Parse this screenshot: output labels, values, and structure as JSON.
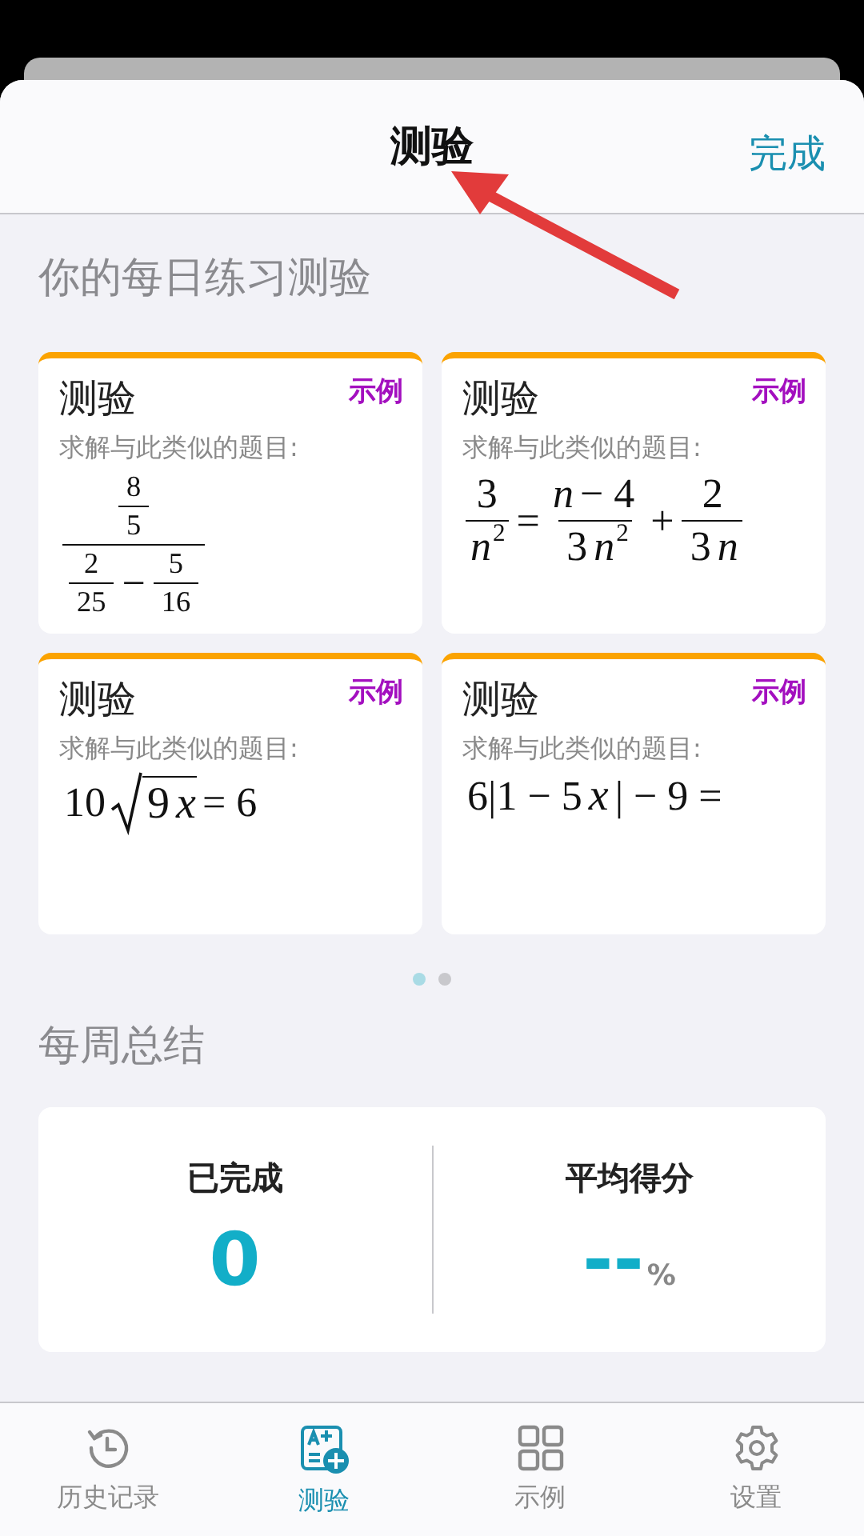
{
  "header": {
    "title": "测验",
    "done": "完成"
  },
  "daily": {
    "heading": "你的每日练习测验",
    "cards": [
      {
        "title": "测验",
        "tag": "示例",
        "prompt": "求解与此类似的题目:",
        "formula": [
          {
            "kind": "frac",
            "num": [
              {
                "kind": "frac",
                "num": [
                  {
                    "kind": "text",
                    "text": "8"
                  }
                ],
                "den": [
                  {
                    "kind": "text",
                    "text": "5"
                  }
                ]
              }
            ],
            "den": [
              {
                "kind": "frac",
                "num": [
                  {
                    "kind": "text",
                    "text": "2"
                  }
                ],
                "den": [
                  {
                    "kind": "text",
                    "text": "25"
                  }
                ]
              },
              {
                "kind": "text",
                "text": "−"
              },
              {
                "kind": "frac",
                "num": [
                  {
                    "kind": "text",
                    "text": "5"
                  }
                ],
                "den": [
                  {
                    "kind": "text",
                    "text": "16"
                  }
                ]
              }
            ]
          }
        ]
      },
      {
        "title": "测验",
        "tag": "示例",
        "prompt": "求解与此类似的题目:",
        "formula": [
          {
            "kind": "frac",
            "num": [
              {
                "kind": "text",
                "text": "3"
              }
            ],
            "den": [
              {
                "kind": "var",
                "text": "n"
              },
              {
                "kind": "sup",
                "text": "2"
              }
            ]
          },
          {
            "kind": "text",
            "text": "="
          },
          {
            "kind": "frac",
            "num": [
              {
                "kind": "var",
                "text": "n"
              },
              {
                "kind": "text",
                "text": "− 4"
              }
            ],
            "den": [
              {
                "kind": "text",
                "text": "3"
              },
              {
                "kind": "var",
                "text": "n"
              },
              {
                "kind": "sup",
                "text": "2"
              }
            ]
          },
          {
            "kind": "text",
            "text": "+"
          },
          {
            "kind": "frac",
            "num": [
              {
                "kind": "text",
                "text": "2"
              }
            ],
            "den": [
              {
                "kind": "text",
                "text": "3"
              },
              {
                "kind": "var",
                "text": "n"
              }
            ]
          }
        ]
      },
      {
        "title": "测验",
        "tag": "示例",
        "prompt": "求解与此类似的题目:",
        "formula": [
          {
            "kind": "text",
            "text": "10"
          },
          {
            "kind": "sqrt",
            "body": [
              {
                "kind": "text",
                "text": "9"
              },
              {
                "kind": "var",
                "text": "x"
              }
            ]
          },
          {
            "kind": "text",
            "text": "= 6"
          }
        ]
      },
      {
        "title": "测验",
        "tag": "示例",
        "prompt": "求解与此类似的题目:",
        "formula": [
          {
            "kind": "text",
            "text": "6|1 − 5"
          },
          {
            "kind": "var",
            "text": "x"
          },
          {
            "kind": "text",
            "text": "| − 9 ="
          }
        ]
      }
    ],
    "pages": [
      {
        "selected": true
      },
      {
        "selected": false
      }
    ]
  },
  "weekly": {
    "heading": "每周总结",
    "stats": [
      {
        "label": "已完成",
        "value": "0"
      },
      {
        "label": "平均得分",
        "value": "--",
        "unit": "%"
      }
    ]
  },
  "tabs": [
    {
      "label": "历史记录",
      "selected": false
    },
    {
      "label": "测验",
      "selected": true
    },
    {
      "label": "示例",
      "selected": false
    },
    {
      "label": "设置",
      "selected": false
    }
  ]
}
